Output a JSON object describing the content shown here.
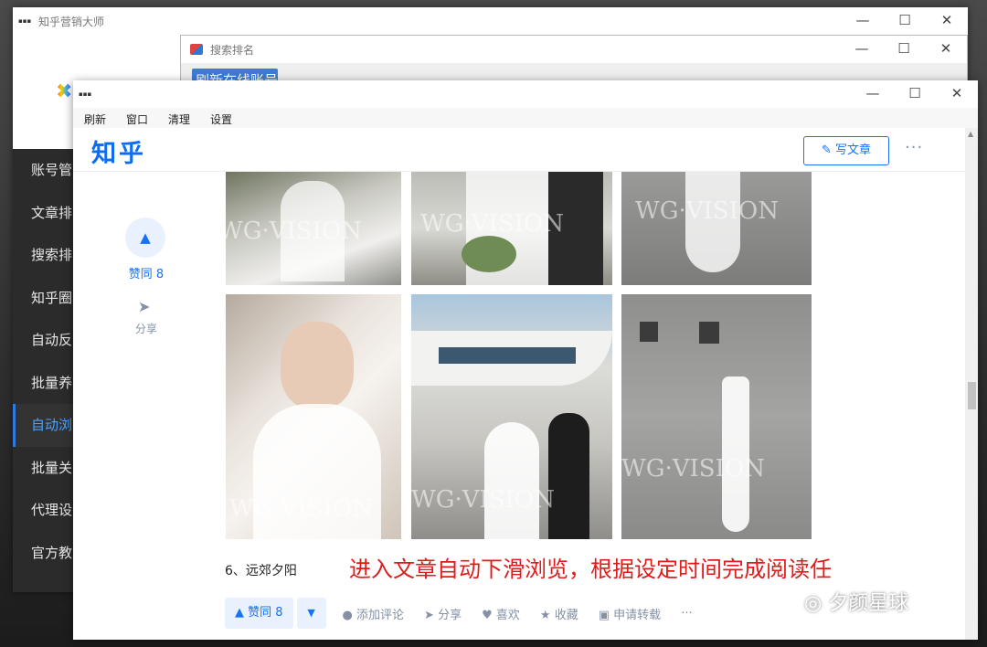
{
  "back_window": {
    "title": "知乎营销大师",
    "sidebar": [
      {
        "label": "账号管"
      },
      {
        "label": "文章排"
      },
      {
        "label": "搜索排"
      },
      {
        "label": "知乎圈"
      },
      {
        "label": "自动反"
      },
      {
        "label": "批量养"
      },
      {
        "label": "自动浏",
        "active": true
      },
      {
        "label": "批量关"
      },
      {
        "label": "代理设"
      },
      {
        "label": "官方教"
      }
    ]
  },
  "search_window": {
    "title": "搜索排名",
    "button_label": "刷新在线账号"
  },
  "window_controls": {
    "minimize": "—",
    "maximize": "☐",
    "close": "✕"
  },
  "browser": {
    "menu": [
      "刷新",
      "窗口",
      "清理",
      "设置"
    ],
    "logo": "知乎",
    "write_article": "写文章",
    "more": "···",
    "vote_label": "赞同 8",
    "share_label": "分享",
    "watermark": "WG·VISION",
    "caption": "6、远郊夕阳",
    "annotation": "进入文章自动下滑浏览，根据设定时间完成阅读任",
    "actions": {
      "vote": "▲ 赞同 8",
      "down": "▼",
      "comment": "添加评论",
      "share": "分享",
      "like": "喜欢",
      "collect": "收藏",
      "repost": "申请转载",
      "more": "···"
    }
  },
  "wechat_watermark": "夕颜星球",
  "icons": {
    "vote": "triangle-up-icon",
    "share": "paper-plane-icon",
    "edit": "edit-icon",
    "comment": "speech-bubble-icon",
    "like": "heart-icon",
    "collect": "star-icon",
    "repost": "repost-icon"
  },
  "colors": {
    "zhihu_blue": "#1772f6",
    "annotation_red": "#e11a1a",
    "sidebar_active": "#4aa3ff"
  }
}
